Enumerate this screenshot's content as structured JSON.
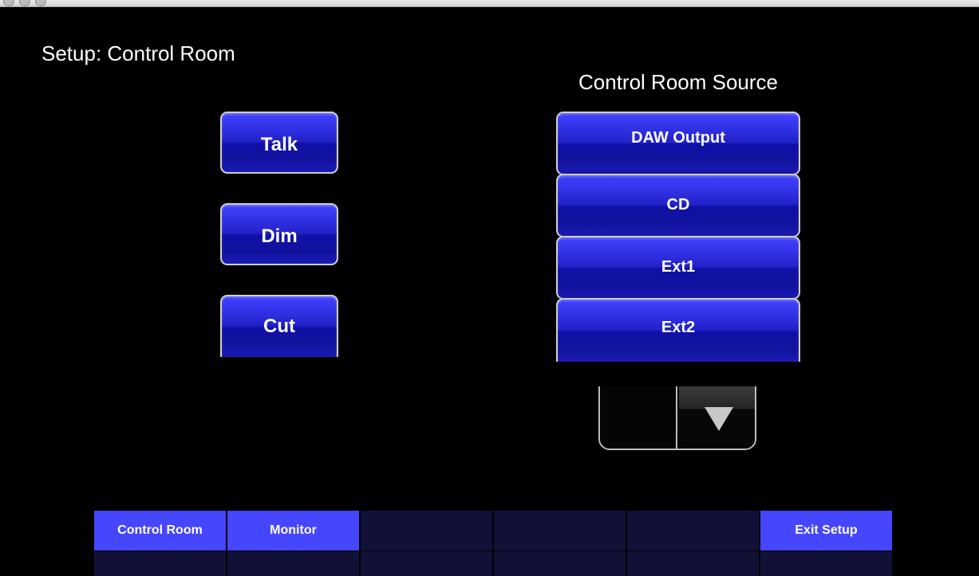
{
  "page": {
    "title": "Setup:  Control Room"
  },
  "left_buttons": [
    {
      "label": "Talk"
    },
    {
      "label": "Dim"
    },
    {
      "label": "Cut"
    }
  ],
  "source": {
    "title": "Control Room Source",
    "items": [
      {
        "label": "DAW Output"
      },
      {
        "label": "CD"
      },
      {
        "label": "Ext1"
      },
      {
        "label": "Ext2"
      }
    ]
  },
  "scroll": {
    "down_icon": "triangle-down-icon"
  },
  "tabs": [
    {
      "label": "Control Room",
      "active": true
    },
    {
      "label": "Monitor",
      "active": true
    },
    {
      "label": "",
      "active": false
    },
    {
      "label": "",
      "active": false
    },
    {
      "label": "",
      "active": false
    },
    {
      "label": "Exit Setup",
      "active": true
    }
  ],
  "colors": {
    "background": "#000000",
    "button_blue": "#2222c8",
    "tab_active": "#4646ff",
    "tab_inactive": "#111138"
  }
}
